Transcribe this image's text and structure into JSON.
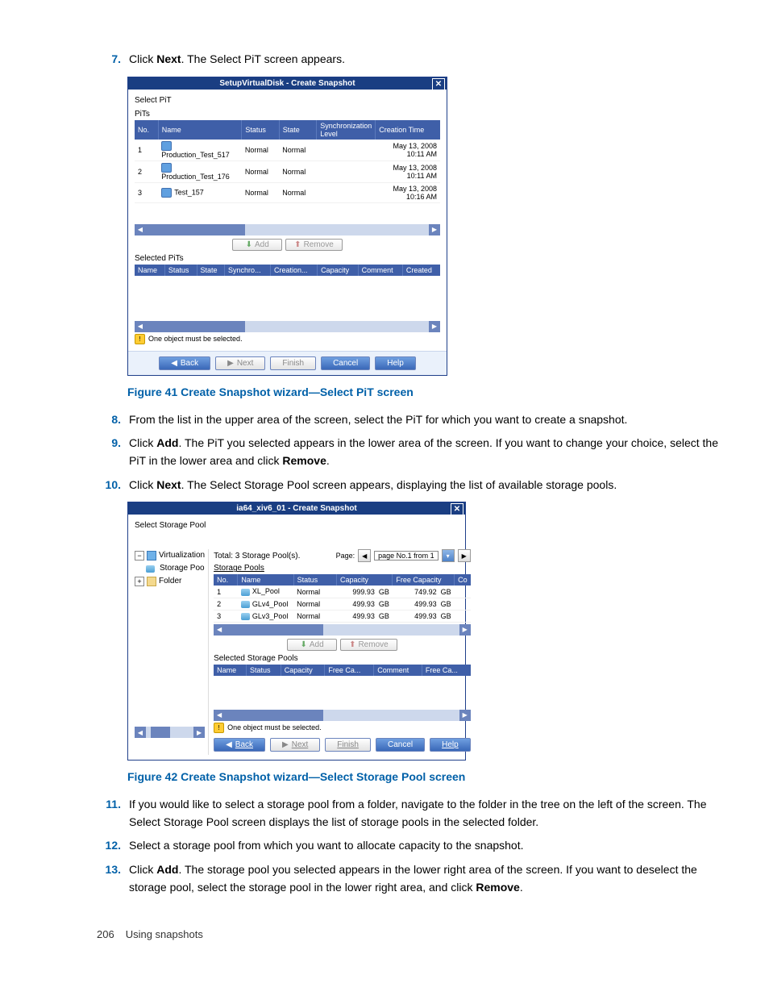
{
  "steps": {
    "s7": {
      "num": "7.",
      "text_a": "Click ",
      "bold_a": "Next",
      "text_b": ". The Select PiT screen appears."
    },
    "s8": {
      "num": "8.",
      "text": "From the list in the upper area of the screen, select the PiT for which you want to create a snapshot."
    },
    "s9": {
      "num": "9.",
      "text_a": "Click ",
      "bold_a": "Add",
      "text_b": ". The PiT you selected appears in the lower area of the screen. If you want to change your choice, select the PiT in the lower area and click ",
      "bold_b": "Remove",
      "text_c": "."
    },
    "s10": {
      "num": "10.",
      "text_a": "Click ",
      "bold_a": "Next",
      "text_b": ". The Select Storage Pool screen appears, displaying the list of available storage pools."
    },
    "s11": {
      "num": "11.",
      "text": "If you would like to select a storage pool from a folder, navigate to the folder in the tree on the left of the screen. The Select Storage Pool screen displays the list of storage pools in the selected folder."
    },
    "s12": {
      "num": "12.",
      "text": "Select a storage pool from which you want to allocate capacity to the snapshot."
    },
    "s13": {
      "num": "13.",
      "text_a": "Click ",
      "bold_a": "Add",
      "text_b": ". The storage pool you selected appears in the lower right area of the screen. If you want to deselect the storage pool, select the storage pool in the lower right area, and click ",
      "bold_b": "Remove",
      "text_c": "."
    }
  },
  "figures": {
    "f41": "Figure 41 Create Snapshot wizard—Select PiT screen",
    "f42": "Figure 42 Create Snapshot wizard—Select Storage Pool screen"
  },
  "dlg1": {
    "title": "SetupVirtualDisk - Create Snapshot",
    "select_pit": "Select PiT",
    "pits": "PiTs",
    "cols": {
      "no": "No.",
      "name": "Name",
      "status": "Status",
      "state": "State",
      "sync": "Synchronization Level",
      "ctime": "Creation Time"
    },
    "rows": [
      {
        "no": "1",
        "name": "Production_Test_517",
        "status": "Normal",
        "state": "Normal",
        "ctime": "May 13, 2008 10:11 AM"
      },
      {
        "no": "2",
        "name": "Production_Test_176",
        "status": "Normal",
        "state": "Normal",
        "ctime": "May 13, 2008 10:11 AM"
      },
      {
        "no": "3",
        "name": "Test_157",
        "status": "Normal",
        "state": "Normal",
        "ctime": "May 13, 2008 10:16 AM"
      }
    ],
    "add": "Add",
    "remove": "Remove",
    "selected_pits": "Selected PiTs",
    "cols2": {
      "name": "Name",
      "status": "Status",
      "state": "State",
      "sync": "Synchro...",
      "creation": "Creation...",
      "capacity": "Capacity",
      "comment": "Comment",
      "created": "Created"
    },
    "warn": "One object must be selected.",
    "back": "Back",
    "next": "Next",
    "finish": "Finish",
    "cancel": "Cancel",
    "help": "Help"
  },
  "dlg2": {
    "title": "ia64_xiv6_01 - Create Snapshot",
    "select_sp": "Select Storage Pool",
    "tree": {
      "virt": "Virtualization",
      "sp": "Storage Poo",
      "folder": "Folder"
    },
    "total": "Total: 3 Storage Pool(s).",
    "page_label": "Page:",
    "page_text": "page No.1 from 1",
    "pools_label": "Storage Pools",
    "cols": {
      "no": "No.",
      "name": "Name",
      "status": "Status",
      "capacity": "Capacity",
      "free": "Free Capacity",
      "co": "Co"
    },
    "rows": [
      {
        "no": "1",
        "name": "XL_Pool",
        "status": "Normal",
        "cap": "999.93",
        "unit": "GB",
        "free": "749.92",
        "funit": "GB"
      },
      {
        "no": "2",
        "name": "GLv4_Pool",
        "status": "Normal",
        "cap": "499.93",
        "unit": "GB",
        "free": "499.93",
        "funit": "GB"
      },
      {
        "no": "3",
        "name": "GLv3_Pool",
        "status": "Normal",
        "cap": "499.93",
        "unit": "GB",
        "free": "499.93",
        "funit": "GB"
      }
    ],
    "add": "Add",
    "remove": "Remove",
    "sel_pools": "Selected Storage Pools",
    "cols2": {
      "name": "Name",
      "status": "Status",
      "capacity": "Capacity",
      "free": "Free Ca...",
      "comment": "Comment",
      "free2": "Free Ca..."
    },
    "warn": "One object must be selected.",
    "back": "Back",
    "next": "Next",
    "finish": "Finish",
    "cancel": "Cancel",
    "help": "Help"
  },
  "footer": {
    "pageno": "206",
    "section": "Using snapshots"
  }
}
